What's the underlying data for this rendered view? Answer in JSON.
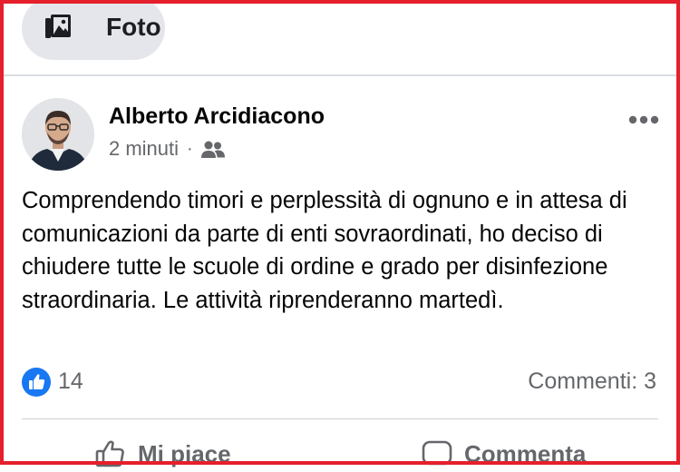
{
  "composer": {
    "photo_label": "Foto",
    "photo_icon": "photo-gallery-icon"
  },
  "post": {
    "author": "Alberto Arcidiacono",
    "time": "2 minuti",
    "separator": "·",
    "audience_icon": "group-audience-icon",
    "text": "Comprendendo timori e perplessità di ognuno e in attesa di comunicazioni da parte di enti sovraordinati, ho deciso di chiudere tutte le scuole di ordine e grado per disinfezione straordinaria. Le attività riprenderanno martedì.",
    "reactions": {
      "icon": "like-reaction-icon",
      "count": "14"
    },
    "comments_label": "Commenti: 3",
    "actions": {
      "like": "Mi piace",
      "comment": "Commenta"
    }
  },
  "colors": {
    "like_blue": "#1877f2",
    "muted": "#65676b",
    "frame_red": "#e5202c"
  }
}
